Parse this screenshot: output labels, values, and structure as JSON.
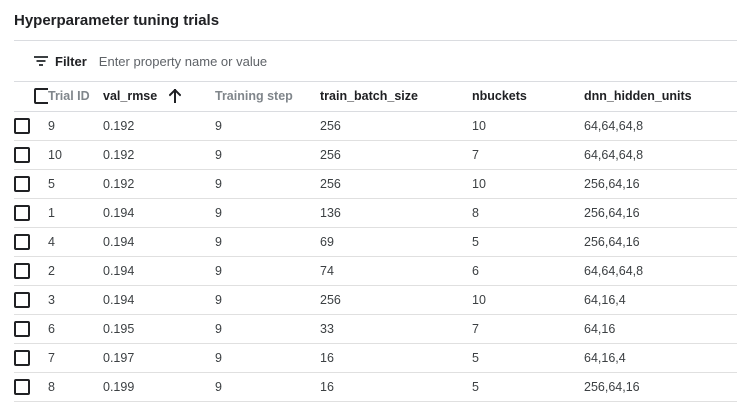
{
  "page": {
    "title": "Hyperparameter tuning trials"
  },
  "filter": {
    "label": "Filter",
    "placeholder": "Enter property name or value",
    "icon": "filter-list-icon"
  },
  "table": {
    "sort": {
      "column": "val_rmse",
      "direction": "ascending",
      "icon": "arrow-upward-icon"
    },
    "columns": [
      "Trial ID",
      "val_rmse",
      "Training step",
      "train_batch_size",
      "nbuckets",
      "dnn_hidden_units"
    ],
    "rows": [
      {
        "trial_id": "9",
        "val_rmse": "0.192",
        "training_step": "9",
        "train_batch_size": "256",
        "nbuckets": "10",
        "dnn_hidden_units": "64,64,64,8"
      },
      {
        "trial_id": "10",
        "val_rmse": "0.192",
        "training_step": "9",
        "train_batch_size": "256",
        "nbuckets": "7",
        "dnn_hidden_units": "64,64,64,8"
      },
      {
        "trial_id": "5",
        "val_rmse": "0.192",
        "training_step": "9",
        "train_batch_size": "256",
        "nbuckets": "10",
        "dnn_hidden_units": "256,64,16"
      },
      {
        "trial_id": "1",
        "val_rmse": "0.194",
        "training_step": "9",
        "train_batch_size": "136",
        "nbuckets": "8",
        "dnn_hidden_units": "256,64,16"
      },
      {
        "trial_id": "4",
        "val_rmse": "0.194",
        "training_step": "9",
        "train_batch_size": "69",
        "nbuckets": "5",
        "dnn_hidden_units": "256,64,16"
      },
      {
        "trial_id": "2",
        "val_rmse": "0.194",
        "training_step": "9",
        "train_batch_size": "74",
        "nbuckets": "6",
        "dnn_hidden_units": "64,64,64,8"
      },
      {
        "trial_id": "3",
        "val_rmse": "0.194",
        "training_step": "9",
        "train_batch_size": "256",
        "nbuckets": "10",
        "dnn_hidden_units": "64,16,4"
      },
      {
        "trial_id": "6",
        "val_rmse": "0.195",
        "training_step": "9",
        "train_batch_size": "33",
        "nbuckets": "7",
        "dnn_hidden_units": "64,16"
      },
      {
        "trial_id": "7",
        "val_rmse": "0.197",
        "training_step": "9",
        "train_batch_size": "16",
        "nbuckets": "5",
        "dnn_hidden_units": "64,16,4"
      },
      {
        "trial_id": "8",
        "val_rmse": "0.199",
        "training_step": "9",
        "train_batch_size": "16",
        "nbuckets": "5",
        "dnn_hidden_units": "256,64,16"
      }
    ]
  }
}
